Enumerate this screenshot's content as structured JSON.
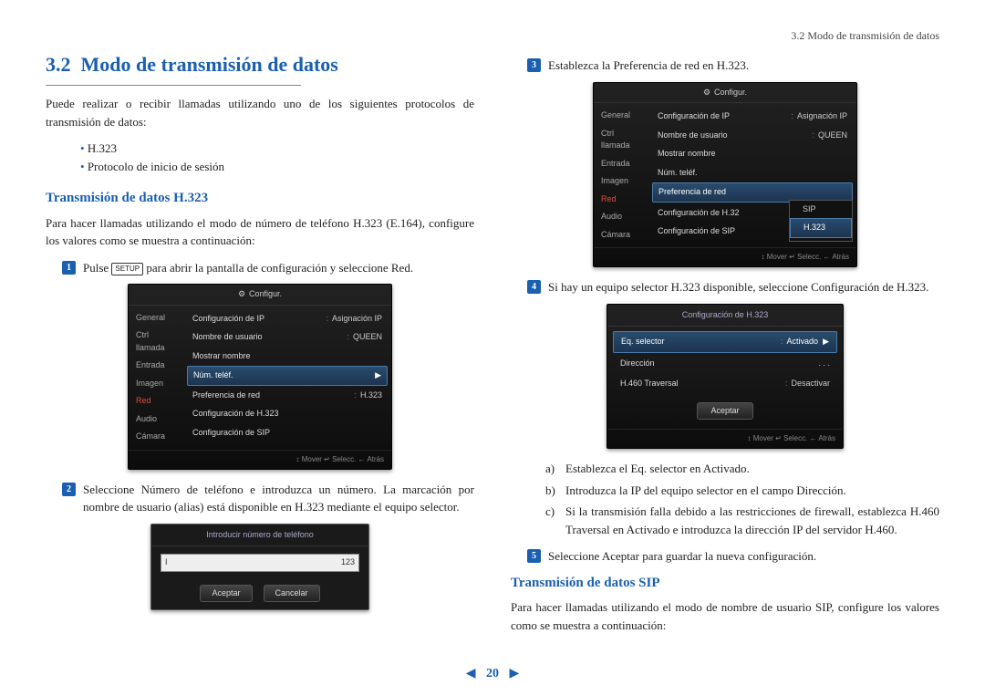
{
  "header": {
    "breadcrumb": "3.2 Modo de transmisión de datos"
  },
  "leftCol": {
    "sectionNumber": "3.2",
    "sectionTitle": "Modo de transmisión de datos",
    "intro": "Puede realizar o recibir llamadas utilizando uno de los siguientes protocolos de transmisión de datos:",
    "bullets": [
      "H.323",
      "Protocolo de inicio de sesión"
    ],
    "subH323": "Transmisión de datos H.323",
    "paraH323": "Para hacer llamadas utilizando el modo de número de teléfono H.323 (E.164), configure los valores como se muestra a continuación:",
    "step1_pre": "Pulse ",
    "step1_key": "SETUP",
    "step1_post": " para abrir la pantalla de configuración y seleccione Red.",
    "step2": "Seleccione Número de teléfono e introduzca un número. La marcación por nombre de usuario (alias) está disponible en H.323 mediante el equipo selector."
  },
  "shot1": {
    "title": "Configur.",
    "side": [
      "General",
      "Ctrl llamada",
      "Entrada",
      "Imagen",
      "Red",
      "Audio",
      "Cámara"
    ],
    "sideSelected": "Red",
    "rows": [
      {
        "label": "Configuración de IP",
        "val": "Asignación IP"
      },
      {
        "label": "Nombre de usuario",
        "val": "QUEEN"
      },
      {
        "label": "Mostrar nombre",
        "val": ""
      },
      {
        "label": "Núm. teléf.",
        "val": "▶",
        "hl": true
      },
      {
        "label": "Preferencia de red",
        "val": "H.323"
      },
      {
        "label": "Configuración de H.323",
        "val": ""
      },
      {
        "label": "Configuración de SIP",
        "val": ""
      }
    ],
    "foot": "↕ Mover   ↵ Selecc.  ← Atrás"
  },
  "popup": {
    "title": "Introducir número de teléfono",
    "cursor": "I",
    "mode": "123",
    "ok": "Aceptar",
    "cancel": "Cancelar"
  },
  "rightCol": {
    "step3": "Establezca la Preferencia de red en H.323.",
    "step4": "Si hay un equipo selector H.323 disponible, seleccione Configuración de H.323.",
    "subA": "Establezca el Eq. selector en Activado.",
    "subB": "Introduzca la IP del equipo selector en el campo Dirección.",
    "subC": "Si la transmisión falla debido a las restricciones de firewall, establezca H.460 Traversal en Activado e introduzca la dirección IP del servidor H.460.",
    "step5": "Seleccione Aceptar para guardar la nueva configuración.",
    "subSIP": "Transmisión de datos SIP",
    "paraSIP": "Para hacer llamadas utilizando el modo de nombre de usuario SIP, configure los valores como se muestra a continuación:"
  },
  "shot2": {
    "title": "Configur.",
    "side": [
      "General",
      "Ctrl llamada",
      "Entrada",
      "Imagen",
      "Red",
      "Audio",
      "Cámara"
    ],
    "sideSelected": "Red",
    "rows": [
      {
        "label": "Configuración de IP",
        "val": "Asignación IP"
      },
      {
        "label": "Nombre de usuario",
        "val": "QUEEN"
      },
      {
        "label": "Mostrar nombre",
        "val": ""
      },
      {
        "label": "Núm. teléf.",
        "val": ""
      },
      {
        "label": "Preferencia de red",
        "val": "",
        "hl": true
      }
    ],
    "dropdown": {
      "opts": [
        "SIP",
        "H.323"
      ],
      "sel": "H.323"
    },
    "remaining": [
      {
        "label": "Configuración de H.32",
        "val": ""
      },
      {
        "label": "Configuración de SIP",
        "val": ""
      }
    ],
    "foot": "↕ Mover   ↵ Selecc.  ← Atrás"
  },
  "cfg2": {
    "title": "Configuración de H.323",
    "rows": [
      {
        "label": "Eq. selector",
        "val": "Activado",
        "hl": true,
        "arrow": true
      },
      {
        "label": "Dirección",
        "val": ".     .     .",
        "hl": false
      },
      {
        "label": "H.460 Traversal",
        "val": "Desactivar",
        "hl": false
      }
    ],
    "btn": "Aceptar",
    "foot": "↕ Mover   ↵ Selecc.  ← Atrás"
  },
  "footer": {
    "page": "20"
  }
}
